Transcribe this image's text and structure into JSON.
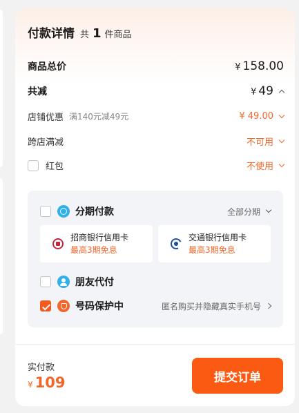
{
  "card": {
    "title": "付款详情",
    "count_prefix": "共",
    "count": "1",
    "count_suffix": "件商品"
  },
  "rows": {
    "total": {
      "label": "商品总价",
      "currency": "¥",
      "value": "158.00"
    },
    "discount": {
      "label": "共减",
      "currency": "¥",
      "value": "49"
    },
    "store_coupon": {
      "label": "店铺优惠",
      "condition": "满140元减49元",
      "value": "¥ 49.00"
    },
    "cross_store": {
      "label": "跨店满减",
      "value": "不可用"
    },
    "red_packet": {
      "label": "红包",
      "value": "不使用",
      "checked": false
    }
  },
  "payment_panel": {
    "installment": {
      "label": "分期付款",
      "hint": "全部分期",
      "checked": false,
      "icon": "installment-icon"
    },
    "banks": [
      {
        "name": "招商银行信用卡",
        "promo": "最高3期免息",
        "icon": "cmb-bank-icon"
      },
      {
        "name": "交通银行信用卡",
        "promo": "最高3期免息",
        "icon": "bocom-bank-icon"
      }
    ],
    "friend_pay": {
      "label": "朋友代付",
      "checked": false,
      "icon": "friend-icon"
    },
    "number_protect": {
      "label": "号码保护中",
      "hint": "匿名购买并隐藏真实手机号",
      "checked": true,
      "icon": "shield-icon"
    }
  },
  "footer": {
    "pay_label": "实付款",
    "currency": "¥",
    "amount": "109",
    "submit_label": "提交订单"
  },
  "colors": {
    "accent": "#f2662a",
    "button": "#fb5a12",
    "panel_bg": "#f2f4f7",
    "page_bg": "#f2f2f2"
  }
}
